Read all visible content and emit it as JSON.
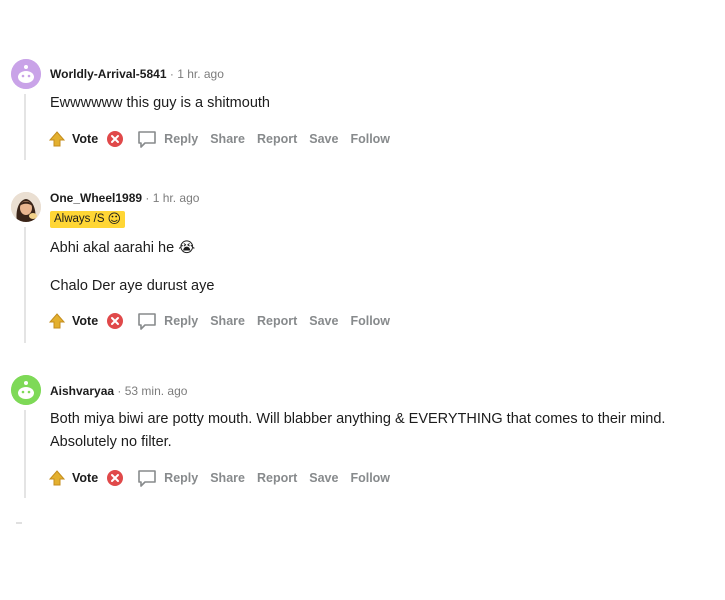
{
  "comments": [
    {
      "author": "Worldly-Arrival-5841",
      "separator": "·",
      "time": "1 hr. ago",
      "lines": [
        "Ewwwwww this guy is a shitmouth"
      ],
      "avatar_color": "#c9a3e8",
      "avatar_icon": "snoo-avatar-icon"
    },
    {
      "author": "One_Wheel1989",
      "separator": "·",
      "time": "1 hr. ago",
      "flair": "Always /S",
      "flair_emoji": "☺",
      "lines": [
        "Abhi akal aarahi he",
        "Chalo Der aye durust aye"
      ],
      "line1_emoji": "😭",
      "avatar_icon": "user-photo-avatar"
    },
    {
      "author": "Aishvaryaa",
      "separator": "·",
      "time": "53 min. ago",
      "lines": [
        "Both miya biwi are potty mouth. Will blabber anything & EVERYTHING that comes to their mind.",
        "Absolutely no filter."
      ],
      "avatar_color": "#7ed957",
      "avatar_icon": "snoo-avatar-icon"
    }
  ],
  "actions": {
    "vote": "Vote",
    "reply": "Reply",
    "share": "Share",
    "report": "Report",
    "save": "Save",
    "follow": "Follow"
  },
  "colors": {
    "upvote_icon": "#e3b02f",
    "downvote_icon": "#e0494a",
    "flair_bg": "#ffd635",
    "muted_text": "#878a8c"
  }
}
